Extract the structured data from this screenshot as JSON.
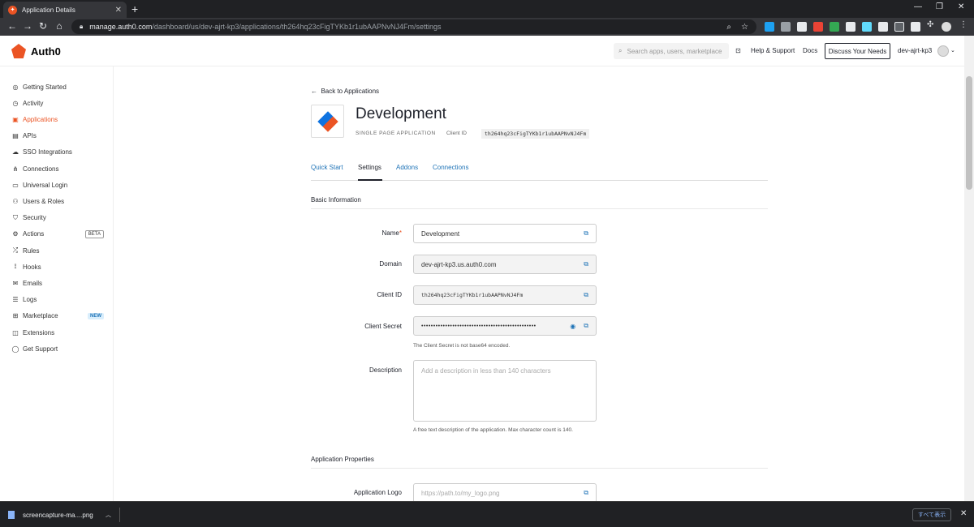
{
  "browser": {
    "tab_title": "Application Details",
    "url_host": "manage.auth0.com",
    "url_path": "/dashboard/us/dev-ajrt-kp3/applications/th264hq23cFigTYKb1r1ubAAPNvNJ4Fm/settings"
  },
  "header": {
    "logo_text": "Auth0",
    "search_placeholder": "Search apps, users, marketplace",
    "help": "Help & Support",
    "docs": "Docs",
    "discuss": "Discuss Your Needs",
    "tenant": "dev-ajrt-kp3"
  },
  "sidebar": {
    "items": [
      {
        "label": "Getting Started",
        "icon": "compass-icon",
        "glyph": "◎"
      },
      {
        "label": "Activity",
        "icon": "activity-icon",
        "glyph": "◷"
      },
      {
        "label": "Applications",
        "icon": "applications-icon",
        "glyph": "▣",
        "active": true
      },
      {
        "label": "APIs",
        "icon": "apis-icon",
        "glyph": "▤"
      },
      {
        "label": "SSO Integrations",
        "icon": "cloud-icon",
        "glyph": "☁"
      },
      {
        "label": "Connections",
        "icon": "connections-icon",
        "glyph": "⋔"
      },
      {
        "label": "Universal Login",
        "icon": "login-icon",
        "glyph": "▭"
      },
      {
        "label": "Users & Roles",
        "icon": "users-icon",
        "glyph": "⚇"
      },
      {
        "label": "Security",
        "icon": "shield-icon",
        "glyph": "⛉"
      },
      {
        "label": "Actions",
        "icon": "actions-icon",
        "glyph": "⚙",
        "badge": "BETA"
      },
      {
        "label": "Rules",
        "icon": "rules-icon",
        "glyph": "⤮"
      },
      {
        "label": "Hooks",
        "icon": "hooks-icon",
        "glyph": "⟟"
      },
      {
        "label": "Emails",
        "icon": "email-icon",
        "glyph": "✉"
      },
      {
        "label": "Logs",
        "icon": "logs-icon",
        "glyph": "☰"
      },
      {
        "label": "Marketplace",
        "icon": "marketplace-icon",
        "glyph": "⊞",
        "badge": "NEW"
      },
      {
        "label": "Extensions",
        "icon": "extensions-icon",
        "glyph": "◫"
      },
      {
        "label": "Get Support",
        "icon": "support-icon",
        "glyph": "◯"
      }
    ]
  },
  "app": {
    "back": "Back to Applications",
    "title": "Development",
    "type": "SINGLE PAGE APPLICATION",
    "client_id_label": "Client ID",
    "client_id": "th264hq23cFigTYKb1r1ubAAPNvNJ4Fm"
  },
  "tabs": [
    "Quick Start",
    "Settings",
    "Addons",
    "Connections"
  ],
  "basic": {
    "section": "Basic Information",
    "name_label": "Name",
    "name_value": "Development",
    "domain_label": "Domain",
    "domain_value": "dev-ajrt-kp3.us.auth0.com",
    "client_id_label": "Client ID",
    "client_id_value": "th264hq23cFigTYKb1r1ubAAPNvNJ4Fm",
    "secret_label": "Client Secret",
    "secret_value": "••••••••••••••••••••••••••••••••••••••••••••••••",
    "secret_hint": "The Client Secret is not base64 encoded.",
    "desc_label": "Description",
    "desc_placeholder": "Add a description in less than 140 characters",
    "desc_hint": "A free text description of the application. Max character count is 140."
  },
  "props": {
    "section": "Application Properties",
    "logo_label": "Application Logo",
    "logo_placeholder": "https://path.to/my_logo.png"
  },
  "download": {
    "file": "screencapture-ma....png",
    "show_all": "すべて表示"
  }
}
